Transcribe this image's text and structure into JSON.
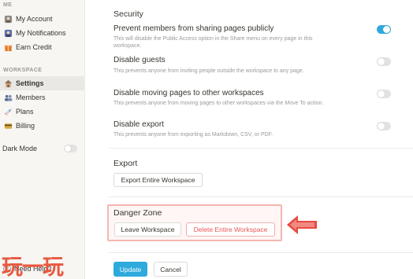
{
  "sidebar": {
    "section_me": "ME",
    "me_items": [
      {
        "label": "My Account",
        "icon": "account-icon"
      },
      {
        "label": "My Notifications",
        "icon": "notifications-icon"
      },
      {
        "label": "Earn Credit",
        "icon": "gift-icon"
      }
    ],
    "section_workspace": "WORKSPACE",
    "workspace_items": [
      {
        "label": "Settings",
        "icon": "settings-house-icon",
        "active": true
      },
      {
        "label": "Members",
        "icon": "members-icon"
      },
      {
        "label": "Plans",
        "icon": "rocket-icon"
      },
      {
        "label": "Billing",
        "icon": "card-icon"
      }
    ],
    "dark_mode_label": "Dark Mode",
    "dark_mode_on": false,
    "need_help": "Need Help?",
    "watermark": "玩一玩"
  },
  "security": {
    "heading": "Security",
    "options": [
      {
        "title": "Prevent members from sharing pages publicly",
        "desc": "This will disable the Public Access option in the Share menu on every page in this workspace.",
        "on": true
      },
      {
        "title": "Disable guests",
        "desc": "This prevents anyone from inviting people outside the workspace to any page.",
        "on": false
      },
      {
        "title": "Disable moving pages to other workspaces",
        "desc": "This prevents anyone from moving pages to other workspaces via the Move To action.",
        "on": false
      },
      {
        "title": "Disable export",
        "desc": "This prevents anyone from exporting as Markdown, CSV, or PDF.",
        "on": false
      }
    ]
  },
  "export": {
    "heading": "Export",
    "button": "Export Entire Workspace"
  },
  "danger": {
    "heading": "Danger Zone",
    "leave_button": "Leave Workspace",
    "delete_button": "Delete Entire Workspace"
  },
  "footer": {
    "update_button": "Update",
    "cancel_button": "Cancel"
  },
  "colors": {
    "accent": "#2eaadc",
    "danger": "#eb5757",
    "highlight_arrow": "#e84a3f"
  }
}
